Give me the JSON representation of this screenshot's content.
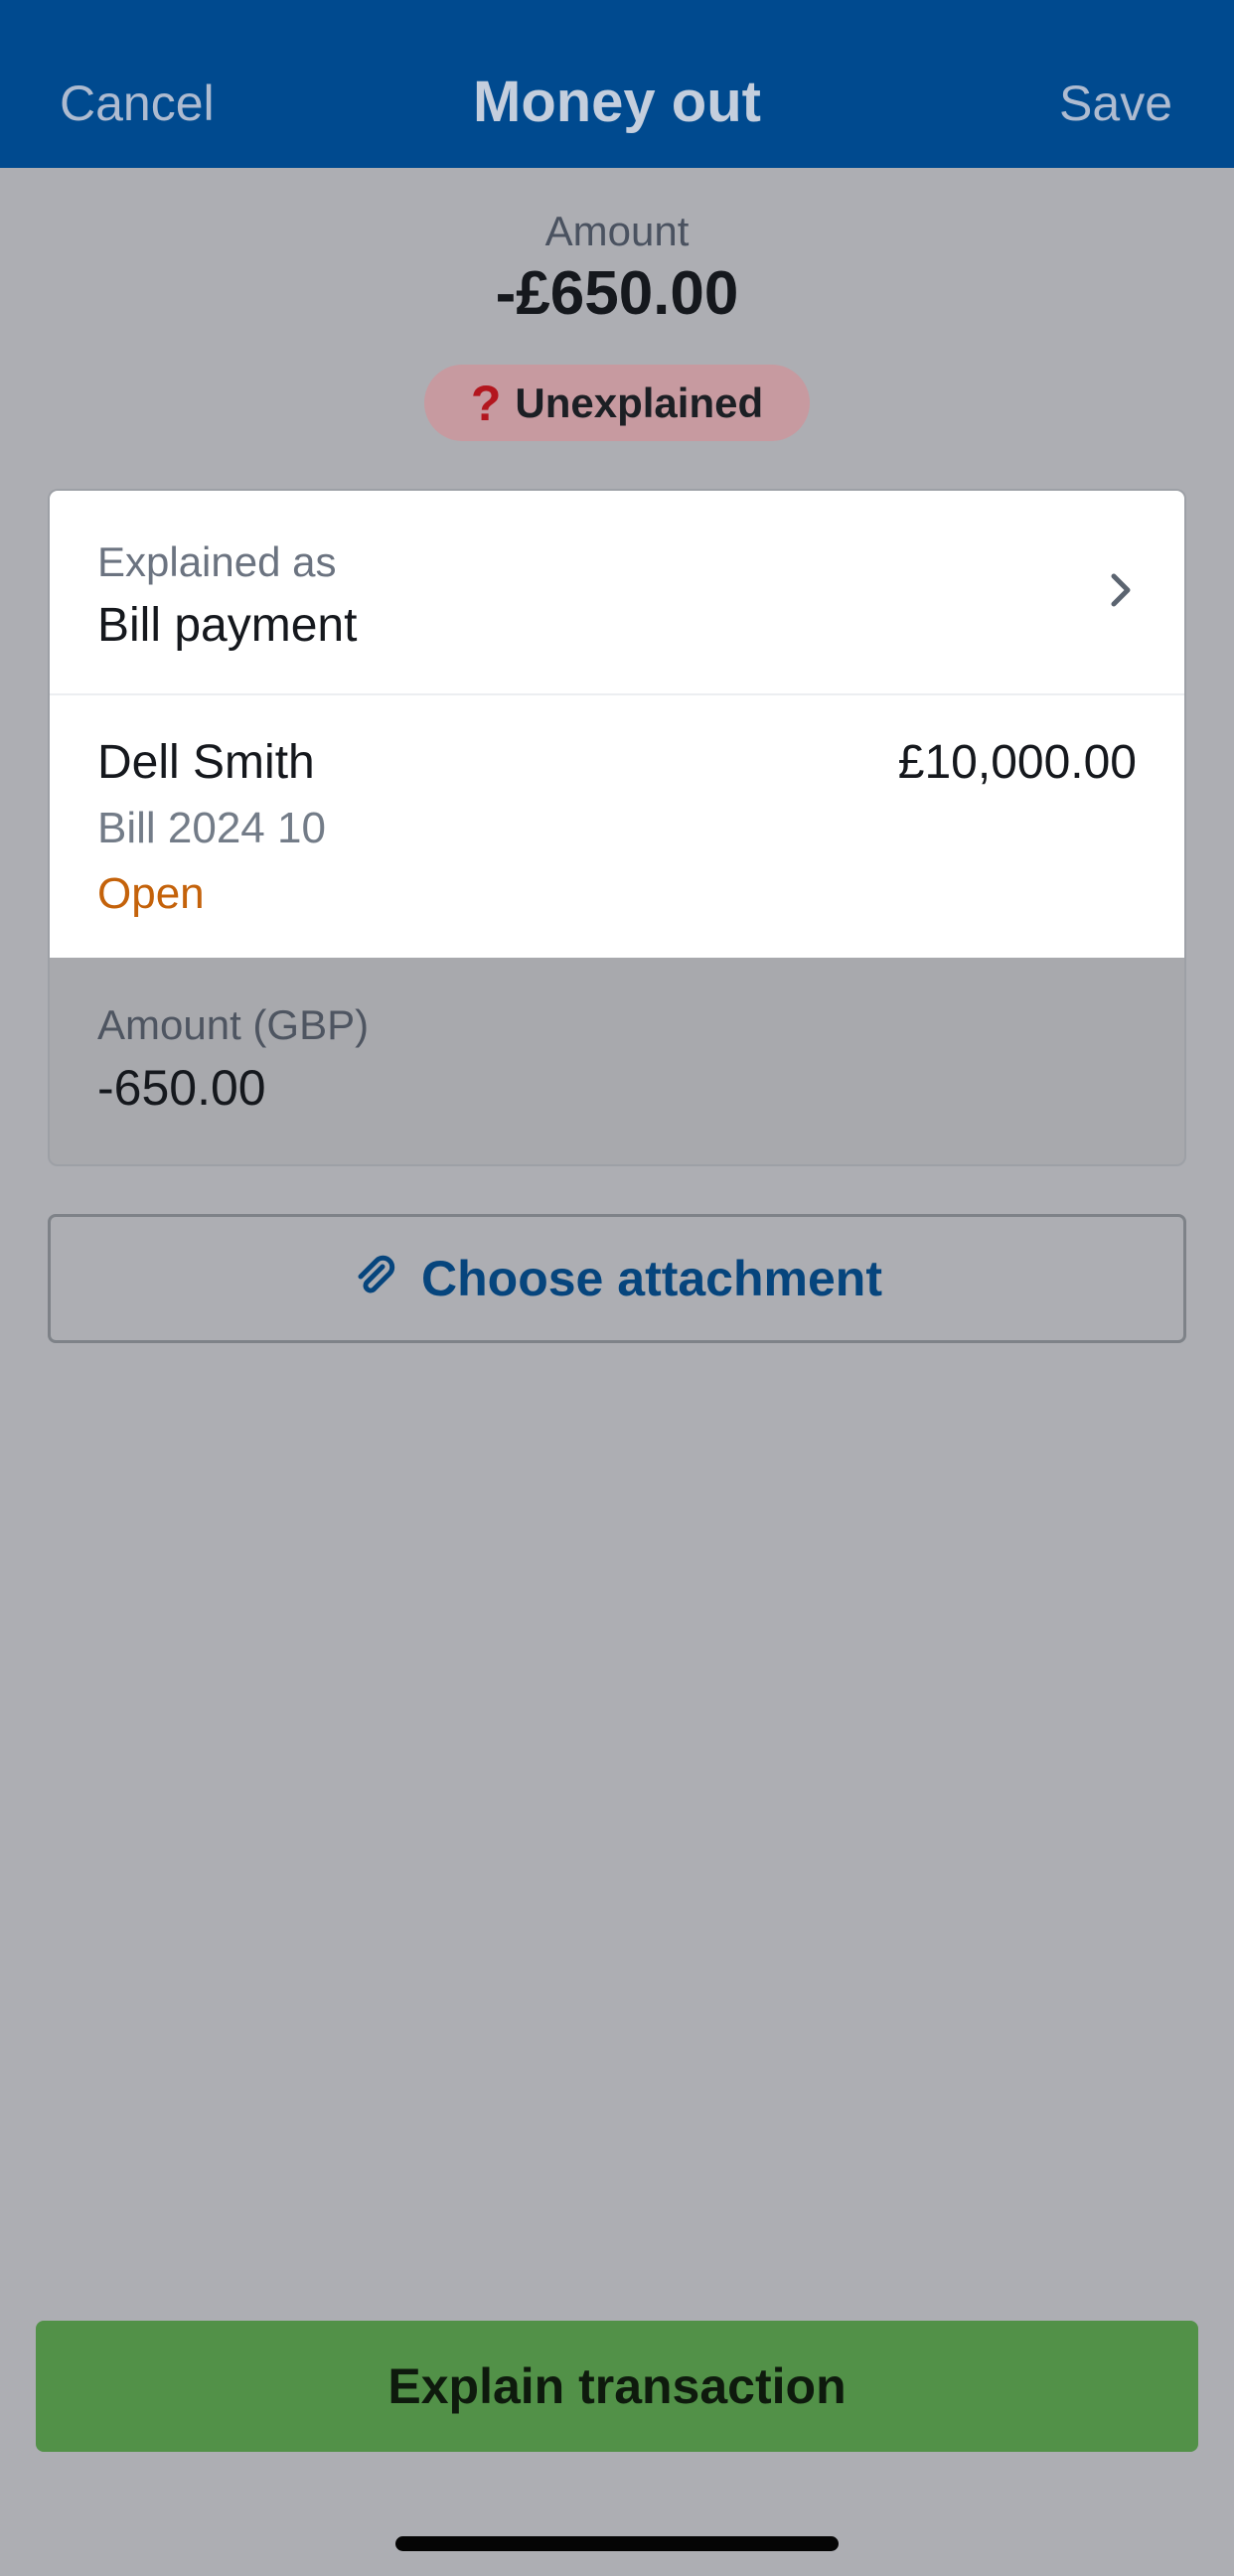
{
  "header": {
    "cancel_label": "Cancel",
    "title": "Money out",
    "save_label": "Save"
  },
  "summary": {
    "amount_label": "Amount",
    "amount_value": "-£650.00",
    "status_icon": "question-mark-icon",
    "status_label": "Unexplained"
  },
  "explanation": {
    "label": "Explained as",
    "value": "Bill payment",
    "chevron_icon": "chevron-right-icon"
  },
  "bill": {
    "contact": "Dell Smith",
    "total": "£10,000.00",
    "reference": "Bill 2024 10",
    "status": "Open"
  },
  "gbp": {
    "label": "Amount (GBP)",
    "value": "-650.00"
  },
  "attachment": {
    "icon": "paperclip-icon",
    "label": "Choose attachment"
  },
  "cta": {
    "label": "Explain transaction"
  },
  "colors": {
    "header_bg": "#004a8f",
    "overlay_bg": "#adaeb3",
    "status_pill_bg": "#c79aa0",
    "open_status": "#c4620a",
    "link_blue": "#06457d",
    "cta_green": "#529148"
  }
}
